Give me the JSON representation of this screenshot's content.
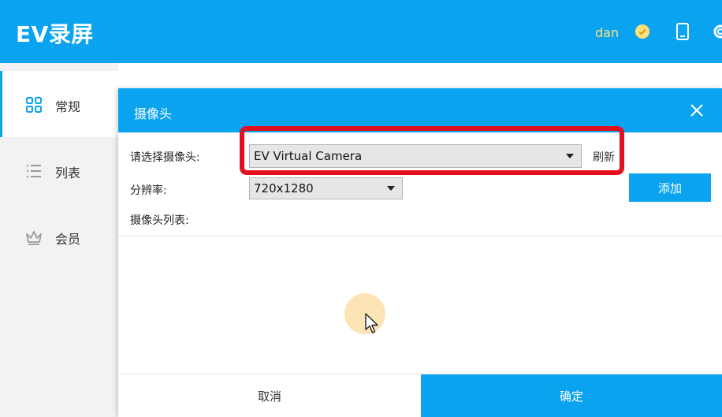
{
  "app": {
    "title": "EV录屏",
    "username": "dan",
    "accent_color": "#0aa3f0",
    "icons": [
      "vip-icon",
      "device-icon",
      "settings-icon"
    ]
  },
  "sidebar": {
    "items": [
      {
        "label": "常规",
        "icon": "grid-icon",
        "active": true
      },
      {
        "label": "列表",
        "icon": "list-icon",
        "active": false
      },
      {
        "label": "会员",
        "icon": "crown-icon",
        "active": false
      }
    ]
  },
  "dialog": {
    "title": "摄像头",
    "close_icon": "close-icon",
    "camera_label": "请选择摄像头:",
    "camera_value": "EV Virtual Camera",
    "refresh_label": "刷新",
    "resolution_label": "分辨率:",
    "resolution_value": "720x1280",
    "add_label": "添加",
    "camera_list_label": "摄像头列表:",
    "camera_list": [],
    "cancel_label": "取消",
    "confirm_label": "确定"
  },
  "annotation": {
    "highlight_color": "#e30f1e"
  }
}
